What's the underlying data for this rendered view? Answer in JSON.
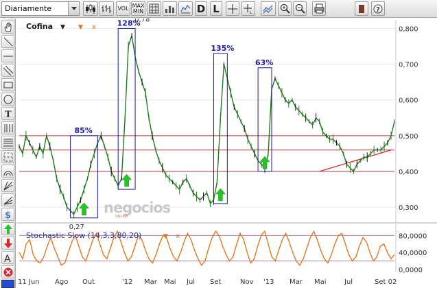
{
  "toolbar": {
    "period": "Diariamente",
    "vol_label": "VOL",
    "maxmin_line1": "MAX",
    "maxmin_line2": "MIN",
    "d_label": "D",
    "l_label": "L"
  },
  "chart": {
    "symbol": "Cofina",
    "indicator_label": "Stochastic Slow (14,3,3,80,20)",
    "watermark": "negocios",
    "watermark_sub": "ONLINE"
  },
  "colors": {
    "price_line": "#1f7a1f",
    "support_lines": "#b83a3a",
    "annotation_boxes": "#1a1aa6",
    "stochastic": "#e07820",
    "arrows": "#27c427"
  },
  "chart_data": {
    "type": "line",
    "title": "Cofina",
    "price_axis": {
      "ticks": [
        "0,800",
        "0,700",
        "0,600",
        "0,500",
        "0,400",
        "0,300"
      ],
      "ylim": [
        0.26,
        0.82
      ]
    },
    "x_ticks": [
      "11 Jun",
      "Ago",
      "Out",
      "'12",
      "Mar",
      "Mai",
      "Jul",
      "Set",
      "Nov",
      "'13",
      "Mar",
      "Mai",
      "Jul",
      "Set 02"
    ],
    "horizontal_lines": [
      0.5,
      0.46,
      0.4
    ],
    "annotations": [
      {
        "label": "85%",
        "low": 0.27,
        "high": 0.5
      },
      {
        "label": "128%",
        "low": 0.35,
        "high": 0.8
      },
      {
        "label": "135%",
        "low": 0.31,
        "high": 0.73
      },
      {
        "label": "63%",
        "low": 0.4,
        "high": 0.69
      }
    ],
    "value_labels": [
      "0,78",
      "0,27"
    ],
    "series": [
      {
        "values": [
          0.47,
          0.45,
          0.5,
          0.48,
          0.46,
          0.44,
          0.47,
          0.45,
          0.5,
          0.47,
          0.43,
          0.38,
          0.35,
          0.33,
          0.3,
          0.29,
          0.28,
          0.3,
          0.32,
          0.35,
          0.38,
          0.42,
          0.45,
          0.48,
          0.5,
          0.47,
          0.44,
          0.4,
          0.38,
          0.36,
          0.38,
          0.55,
          0.75,
          0.78,
          0.72,
          0.68,
          0.65,
          0.62,
          0.55,
          0.5,
          0.46,
          0.43,
          0.41,
          0.39,
          0.38,
          0.37,
          0.36,
          0.35,
          0.37,
          0.38,
          0.36,
          0.34,
          0.33,
          0.32,
          0.33,
          0.34,
          0.31,
          0.32,
          0.37,
          0.55,
          0.7,
          0.66,
          0.62,
          0.58,
          0.56,
          0.54,
          0.52,
          0.49,
          0.47,
          0.45,
          0.43,
          0.42,
          0.41,
          0.45,
          0.63,
          0.66,
          0.64,
          0.62,
          0.6,
          0.59,
          0.6,
          0.58,
          0.57,
          0.56,
          0.55,
          0.54,
          0.53,
          0.55,
          0.54,
          0.51,
          0.5,
          0.49,
          0.49,
          0.48,
          0.47,
          0.45,
          0.42,
          0.41,
          0.4,
          0.42,
          0.43,
          0.44,
          0.44,
          0.45,
          0.46,
          0.46,
          0.46,
          0.47,
          0.48,
          0.5,
          0.54
        ]
      }
    ],
    "stochastic": {
      "ticks": [
        "80,0000",
        "40,0000",
        "0,0000"
      ],
      "ylim": [
        0,
        100
      ],
      "levels": [
        80,
        20
      ],
      "values": [
        40,
        25,
        60,
        70,
        35,
        20,
        15,
        30,
        55,
        75,
        50,
        30,
        10,
        15,
        40,
        65,
        80,
        55,
        30,
        20,
        45,
        70,
        85,
        60,
        35,
        25,
        50,
        75,
        90,
        65,
        40,
        20,
        30,
        55,
        80,
        70,
        45,
        25,
        15,
        35,
        60,
        80,
        75,
        50,
        30,
        20,
        40,
        65,
        85,
        70,
        45,
        25,
        10,
        20,
        50,
        75,
        90,
        80,
        55,
        35,
        20,
        30,
        60,
        85,
        70,
        40,
        15,
        25,
        55,
        80,
        90,
        60,
        30,
        20,
        45,
        70,
        85,
        65,
        40,
        20,
        10,
        25,
        50,
        75,
        90,
        70,
        45,
        25,
        15,
        35,
        60,
        80,
        85,
        60,
        35,
        20,
        30,
        55,
        75,
        65,
        40,
        20,
        30,
        55,
        60,
        40,
        25,
        35
      ]
    }
  }
}
